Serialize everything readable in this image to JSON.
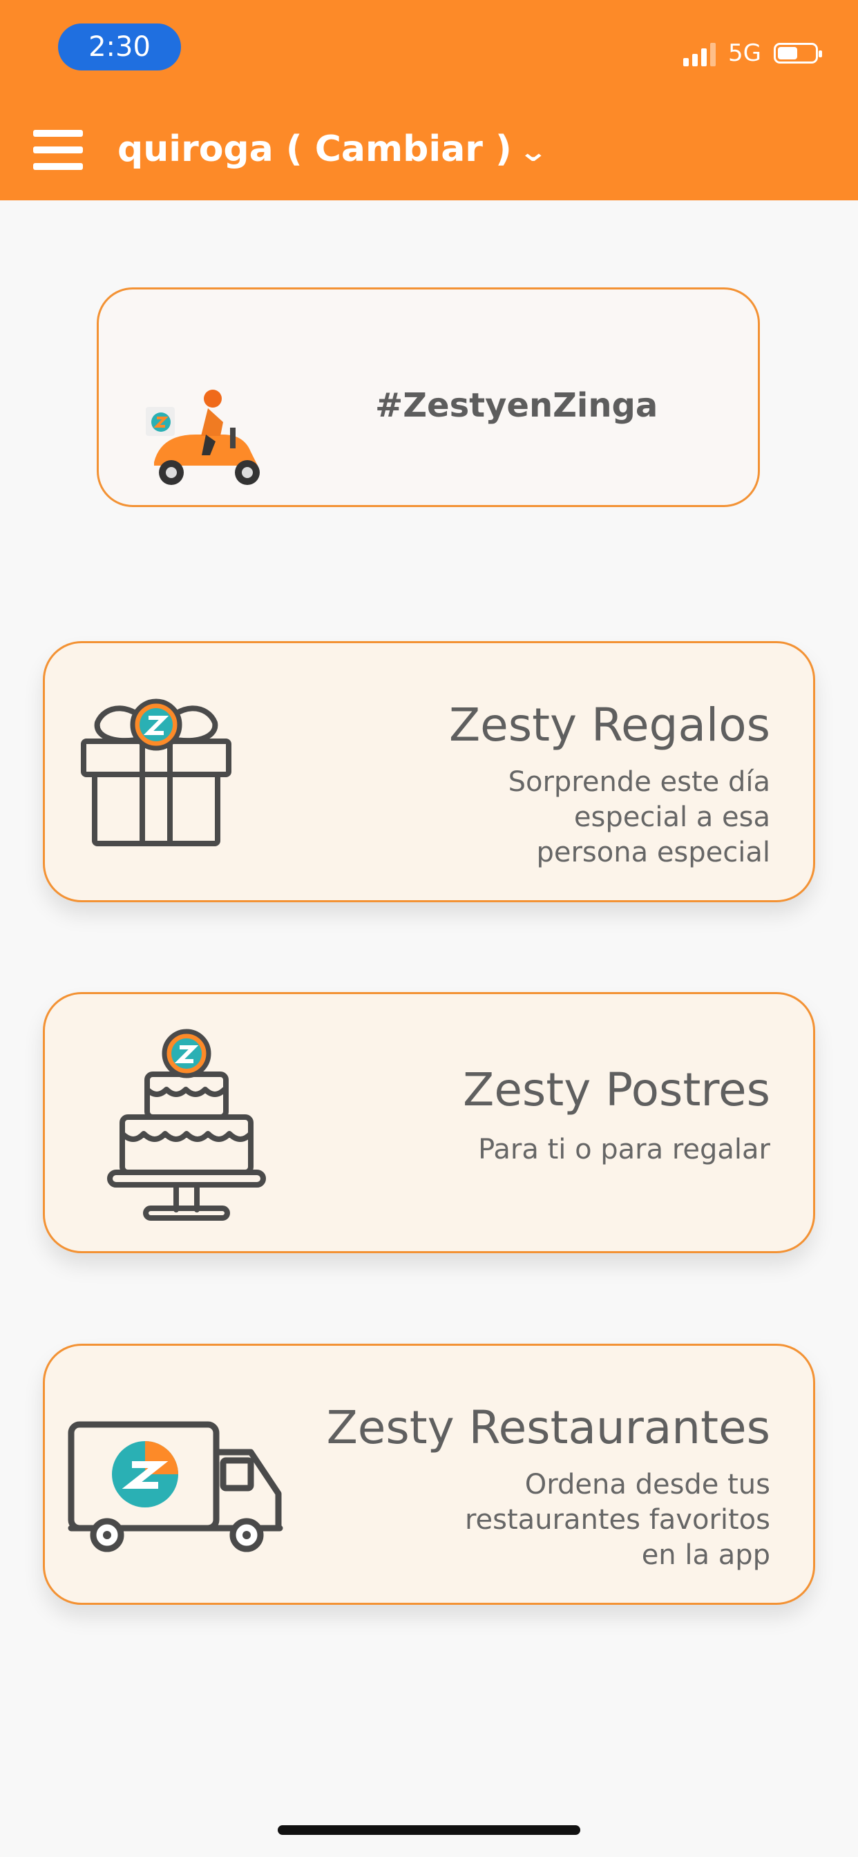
{
  "status_bar": {
    "time": "2:30",
    "network": "5G"
  },
  "header": {
    "location": "quiroga ( Cambiar )"
  },
  "promo": {
    "text": "#ZestyenZinga"
  },
  "cards": [
    {
      "title": "Zesty Regalos",
      "description": "Sorprende este día\nespecial a esa\npersona especial"
    },
    {
      "title": "Zesty Postres",
      "description": "Para ti o para regalar"
    },
    {
      "title": "Zesty Restaurantes",
      "description": "Ordena desde tus\nrestaurantes favoritos\nen la app"
    }
  ],
  "colors": {
    "brand_orange": "#fd8a28",
    "card_border": "#f39234",
    "logo_teal": "#2ab0b4"
  },
  "icons": [
    "menu-icon",
    "chevron-down-icon",
    "signal-icon",
    "battery-icon",
    "scooter-icon",
    "gift-icon",
    "cake-icon",
    "truck-icon"
  ]
}
